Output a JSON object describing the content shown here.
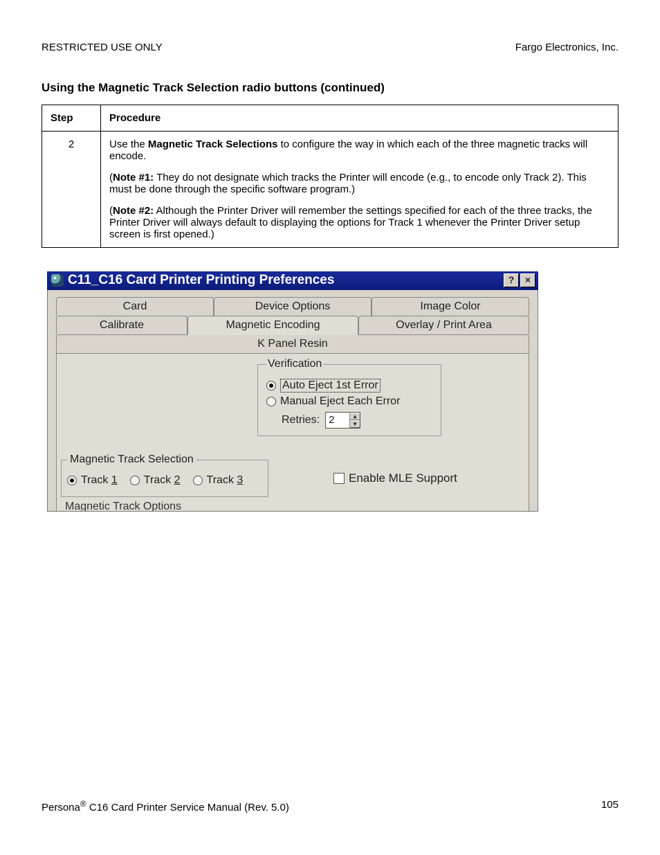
{
  "header": {
    "left": "RESTRICTED USE ONLY",
    "right": "Fargo Electronics, Inc."
  },
  "section_title": "Using the Magnetic Track Selection radio buttons (continued)",
  "table": {
    "headers": [
      "Step",
      "Procedure"
    ],
    "row": {
      "step": "2",
      "p1_a": "Use the ",
      "p1_b": "Magnetic Track Selections",
      "p1_c": " to configure the way in which each of the three magnetic tracks will encode.",
      "p2_a": "(",
      "p2_b": "Note #1:",
      "p2_c": "  They do not designate which tracks the Printer will encode (e.g., to encode only Track 2). This must be done through the specific software program.)",
      "p3_a": "(",
      "p3_b": "Note #2:",
      "p3_c": "  Although the Printer Driver will remember the settings specified for each of the three tracks, the Printer Driver will always default to displaying the options for Track 1 whenever the Printer Driver setup screen is first opened.)"
    }
  },
  "dialog": {
    "title": "C11_C16 Card Printer Printing Preferences",
    "help_btn": "?",
    "close_btn": "×",
    "tabs_back": [
      "Card",
      "Device Options",
      "Image Color",
      "Calibrate"
    ],
    "tabs_front": [
      "Magnetic Encoding",
      "Overlay / Print Area",
      "K Panel Resin"
    ],
    "verification": {
      "legend": "Verification",
      "opt1": "Auto Eject 1st Error",
      "opt2": "Manual Eject Each Error",
      "retries_label": "Retries:",
      "retries_value": "2"
    },
    "track_selection": {
      "legend": "Magnetic Track Selection",
      "t1_pre": "Track ",
      "t1_u": "1",
      "t2_pre": "Track ",
      "t2_u": "2",
      "t3_pre": "Track ",
      "t3_u": "3"
    },
    "mle_label": "Enable MLE Support",
    "mto_label": "Magnetic Track Options"
  },
  "footer": {
    "left_a": "Persona",
    "left_b": " C16 Card Printer Service Manual (Rev. 5.0)",
    "page_no": "105"
  }
}
